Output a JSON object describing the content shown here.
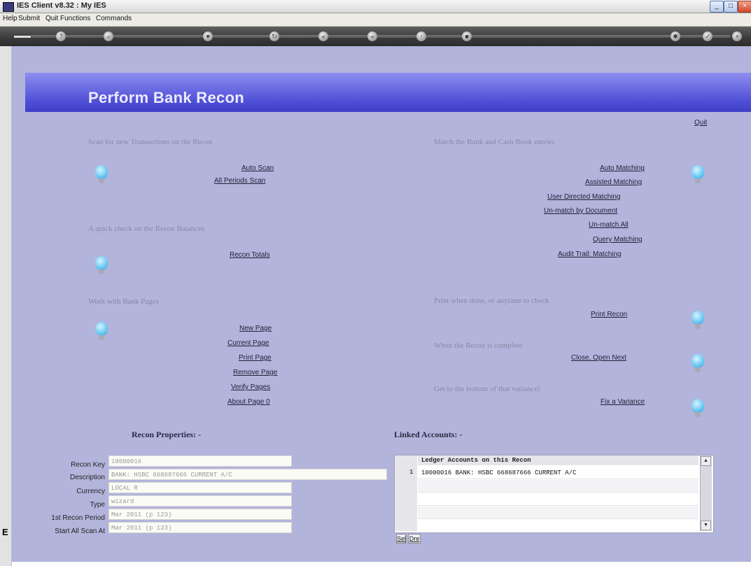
{
  "window": {
    "title": "IES Client v8.32 : My IES"
  },
  "menu": [
    "Help",
    "Submit",
    "Quit",
    "Functions",
    "Commands"
  ],
  "page": {
    "title": "Perform Bank Recon",
    "quit": "Quit"
  },
  "sections": {
    "scan": {
      "heading": "Scan for new Transactions on the Recon",
      "links": [
        "Auto Scan",
        "All Periods Scan"
      ]
    },
    "check": {
      "heading": "A quick check on the Recon Balances",
      "links": [
        "Recon Totals"
      ]
    },
    "pages": {
      "heading": "Work with Bank Pages",
      "links": [
        "New Page",
        "Current Page",
        "Print Page",
        "Remove Page",
        "Verify Pages",
        "About Page 0"
      ]
    },
    "match": {
      "heading": "Match the Bank and Cash Book entries",
      "links": [
        "Auto Matching",
        "Assisted Matching",
        "User Directed Matching",
        "Un-match by Document",
        "Un-match All",
        "Query Matching",
        "Audit Trail: Matching"
      ]
    },
    "print": {
      "heading": "Print when done, or anytime to check",
      "link": "Print Recon"
    },
    "complete": {
      "heading": "When the Recon is complete",
      "link": "Close, Open Next"
    },
    "variance": {
      "heading": "Get to the bottom of that variance!",
      "link": "Fix a Variance"
    }
  },
  "properties": {
    "heading": "Recon Properties: -",
    "fields": [
      {
        "label": "Recon Key",
        "value": "10000016"
      },
      {
        "label": "Description",
        "value": "BANK: HSBC 668687666 CURRENT A/C"
      },
      {
        "label": "Currency",
        "value": "LOCAL R"
      },
      {
        "label": "Type",
        "value": "wizard"
      },
      {
        "label": "1st Recon Period",
        "value": "Mar 2011 (p 123)"
      },
      {
        "label": "Start All Scan At",
        "value": "Mar 2011 (p 123)"
      }
    ]
  },
  "linked": {
    "heading": "Linked Accounts: -",
    "column": "Ledger Accounts on this Recon",
    "rows": [
      {
        "num": "1",
        "text": "10000016 BANK: HSBC 668687666 CURRENT A/C"
      }
    ],
    "buttons": [
      "Sel",
      "Dre"
    ]
  },
  "side": {
    "letter": "E"
  }
}
